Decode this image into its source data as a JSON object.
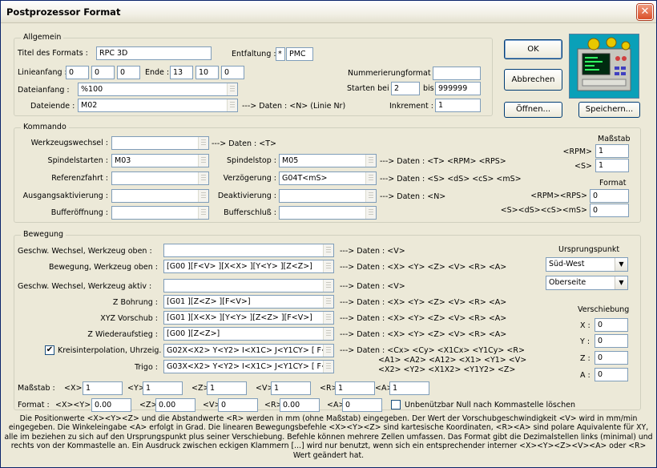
{
  "window": {
    "title": "Postprozessor Format",
    "close": "✕"
  },
  "allgemein": {
    "label": "Allgemein",
    "titel_label": "Titel des Formats :",
    "titel_value": "RPC 3D",
    "entfaltung_label": "Entfaltung :",
    "entfaltung_check": "*",
    "entfaltung_value": "PMC",
    "linienanfang_label": "Linieanfang :",
    "lin1": "0",
    "lin2": "0",
    "lin3": "0",
    "ende_label": "Ende :",
    "ende1": "13",
    "ende2": "10",
    "ende3": "0",
    "nummer_label": "Nummerierungformat :",
    "nummer_value": "",
    "dateianfang_label": "Dateianfang :",
    "dateianfang_value": "%100",
    "starten_label": "Starten bei",
    "starten_value": "2",
    "bis_label": "bis",
    "bis_value": "999999",
    "dateiende_label": "Dateiende :",
    "dateiende_value": "M02",
    "dateiende_info": "---> Daten : <N> (Linie Nr)",
    "inkrement_label": "Inkrement :",
    "inkrement_value": "1"
  },
  "buttons": {
    "ok": "OK",
    "abbrechen": "Abbrechen",
    "oeffnen": "Öffnen...",
    "speichern": "Speichern..."
  },
  "kommando": {
    "label": "Kommando",
    "werkzeug_label": "Werkzeugswechsel :",
    "werkzeug_value": "",
    "werkzeug_info": "---> Daten : <T>",
    "spindelstart_label": "Spindelstarten :",
    "spindelstart_value": "M03",
    "spindelstop_label": "Spindelstop :",
    "spindelstop_value": "M05",
    "spindelstop_info": "---> Daten : <T> <RPM> <RPS>",
    "referenz_label": "Referenzfahrt :",
    "referenz_value": "",
    "verzoegerung_label": "Verzögerung :",
    "verzoegerung_value": "G04T<mS>",
    "verzoegerung_info": "---> Daten : <S> <dS> <cS> <mS>",
    "ausgang_label": "Ausgangsaktivierung :",
    "ausgang_value": "",
    "deaktiv_label": "Deaktivierung :",
    "deaktiv_value": "",
    "deaktiv_info": "---> Daten : <N>",
    "buffer_label": "Bufferöffnung :",
    "buffer_value": "",
    "bufferschluss_label": "Bufferschluß :",
    "bufferschluss_value": "",
    "massstab_label": "Maßstab",
    "rpm_label": "<RPM>",
    "rpm_value": "1",
    "s_label": "<S>",
    "s_value": "1",
    "format_label": "Format",
    "rpmrps_label": "<RPM><RPS>",
    "rpmrps_value": "0",
    "sdscsms_label": "<S><dS><cS><mS>",
    "sdscsms_value": "0"
  },
  "bewegung": {
    "label": "Bewegung",
    "gw_oben_label": "Geschw. Wechsel, Werkzeug oben :",
    "gw_oben_value": "",
    "gw_oben_info": "---> Daten : <V>",
    "bw_oben_label": "Bewegung, Werkzeug oben :",
    "bw_oben_value": "[G00 ][F<V> ][X<X> ][Y<Y> ][Z<Z>]",
    "bw_oben_info": "---> Daten : <X> <Y> <Z> <V> <R> <A>",
    "gw_aktiv_label": "Geschw. Wechsel, Werkzeug aktiv :",
    "gw_aktiv_value": "",
    "gw_aktiv_info": "---> Daten : <V>",
    "bohrung_label": "Z  Bohrung :",
    "bohrung_value": "[G01 ][Z<Z> ][F<V>]",
    "bohrung_info": "---> Daten : <X> <Y> <Z> <V> <R> <A>",
    "xyz_label": "XYZ  Vorschub :",
    "xyz_value": "[G01 ][X<X> ][Y<Y> ][Z<Z> ][F<V>]",
    "xyz_info": "---> Daten : <X> <Y> <Z> <V> <R> <A>",
    "wieder_label": "Z  Wiederaufstieg :",
    "wieder_value": "[G00 ][Z<Z>]",
    "wieder_info": "---> Daten : <X> <Y> <Z> <V> <R> <A>",
    "kreis_check": "✔",
    "kreis_label": "Kreisinterpolation, Uhrzeig. :",
    "kreis_value": "G02X<X2> Y<Y2> I<X1C> J<Y1CY> [ F<V>]",
    "kreis_info1": "---> Daten : <Cx> <Cy> <X1Cx> <Y1Cy> <R>",
    "kreis_info2": "<A1> <A2> <A12> <X1> <Y1> <V>",
    "kreis_info3": "<X2> <Y2> <X1X2> <Y1Y2> <Z>",
    "trigo_label": "Trigo :",
    "trigo_value": "G03X<X2> Y<Y2> I<X1C> J<Y1CY> [ F<V>]",
    "massstab_label": "Maßstab :",
    "m_x_label": "<X>",
    "m_x": "1",
    "m_y_label": "<Y>",
    "m_y": "1",
    "m_z_label": "<Z>",
    "m_z": "1",
    "m_v_label": "<V>",
    "m_v": "1",
    "m_r_label": "<R>",
    "m_r": "1",
    "m_a_label": "<A>",
    "m_a": "1",
    "format_label": "Format :",
    "f_xy_label": "<X><Y>",
    "f_xy": "0.00",
    "f_z_label": "<Z>",
    "f_z": "0.00",
    "f_v_label": "<V>",
    "f_v": "0",
    "f_r_label": "<R>",
    "f_r": "0.00",
    "f_a_label": "<A>",
    "f_a": "0",
    "null_label": "Unbenützbar Null nach Kommastelle löschen",
    "ursprung_label": "Ursprungspunkt",
    "ursprung_value": "Süd-West",
    "seite_value": "Oberseite",
    "verschiebung_label": "Verschiebung",
    "vx_label": "X :",
    "vx": "0",
    "vy_label": "Y :",
    "vy": "0",
    "vz_label": "Z :",
    "vz": "0",
    "va_label": "A :",
    "va": "0"
  },
  "note": "Die Positionwerte <X><Y><Z> und die Abstandwerte <R> werden in mm (ohne Maßstab) eingegeben. Der Wert der Vorschubgeschwindigkeit <V> wird in mm/min eingegeben. Die Winkeleingabe <A> erfolgt in Grad. Die linearen Bewegungsbefehle <X><Y><Z> sind kartesische Koordinaten, <R><A> sind polare Aquivalente für XY, alle im beziehen zu sich auf den Ursprungspunkt plus seiner Verschiebung. Befehle können mehrere Zellen umfassen. Das Format gibt die Dezimalstellen links (minimal) und rechts von der Kommastelle an. Ein Ausdruck zwischen eckigen Klammern [...] wird nur benutzt, wenn sich ein entsprechender interner <X><Y><Z><V><A> oder <R> Wert geändert hat."
}
